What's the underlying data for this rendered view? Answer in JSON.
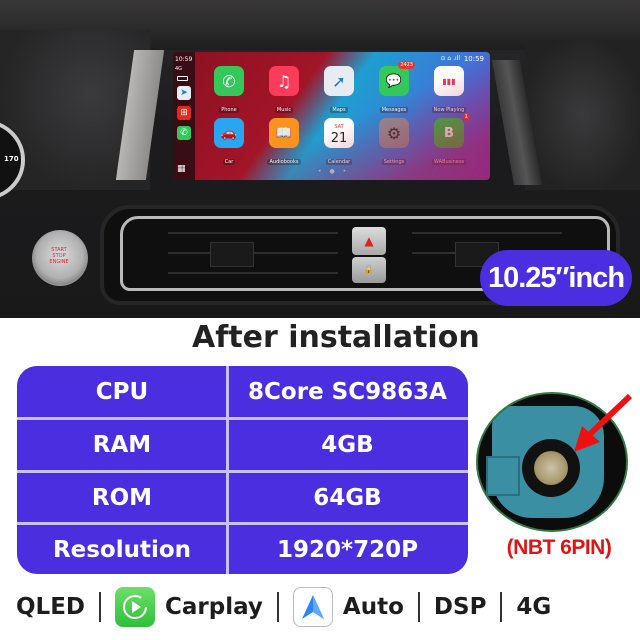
{
  "photo": {
    "gauge_value": "170",
    "start_button_text": "START STOP ENGINE",
    "screen": {
      "dock": {
        "time": "10:59",
        "signal": "4G",
        "apps": [
          {
            "name": "navigation",
            "glyph": "➤",
            "color": "#e8eef8"
          },
          {
            "name": "media",
            "glyph": "⊞",
            "color": "#e02b20"
          },
          {
            "name": "phone",
            "glyph": "✆",
            "color": "#34c759"
          }
        ],
        "grid_glyph": "▦"
      },
      "status_time": "10:59",
      "status_icons": "⊙ ⌂ .ıll",
      "apps": [
        {
          "label": "Phone",
          "glyph": "✆",
          "color": "#34c759",
          "badge": ""
        },
        {
          "label": "Music",
          "glyph": "♫",
          "color": "#fa3c5a",
          "badge": ""
        },
        {
          "label": "Maps",
          "glyph": "➚",
          "color": "#e6ecf2",
          "badge": ""
        },
        {
          "label": "Messages",
          "glyph": "💬",
          "color": "#34c759",
          "badge": "2423"
        },
        {
          "label": "Now Playing",
          "glyph": "▮▮▮",
          "color": "#ffffff",
          "badge": ""
        },
        {
          "label": "Car",
          "glyph": "🚗",
          "color": "#2aa5f0",
          "badge": ""
        },
        {
          "label": "Audiobooks",
          "glyph": "📖",
          "color": "#f7931e",
          "badge": ""
        },
        {
          "label": "Calendar",
          "glyph": "21",
          "color": "#ffffff",
          "badge": "",
          "day": "SAT"
        },
        {
          "label": "Settings",
          "glyph": "⚙",
          "color": "#8e8e93",
          "badge": ""
        },
        {
          "label": "WABusiness",
          "glyph": "B",
          "color": "#2fbf4a",
          "badge": "1"
        }
      ],
      "page_dots": "• ● •"
    },
    "hazard_glyph": "▲",
    "lock_glyph": "🔒",
    "size_label": "10.25″inch"
  },
  "title": "After installation",
  "specs": [
    {
      "key": "CPU",
      "value": "8Core SC9863A"
    },
    {
      "key": "RAM",
      "value": "4GB"
    },
    {
      "key": "ROM",
      "value": "64GB"
    },
    {
      "key": "Resolution",
      "value": "1920*720P"
    }
  ],
  "connector_label": "(NBT 6PIN)",
  "features": {
    "qled": "QLED",
    "carplay": "Carplay",
    "auto": "Auto",
    "dsp": "DSP",
    "fourg": "4G"
  },
  "colors": {
    "accent_purple": "#4b2ee0",
    "divider": "#c9bff7",
    "label_red": "#e01414"
  }
}
